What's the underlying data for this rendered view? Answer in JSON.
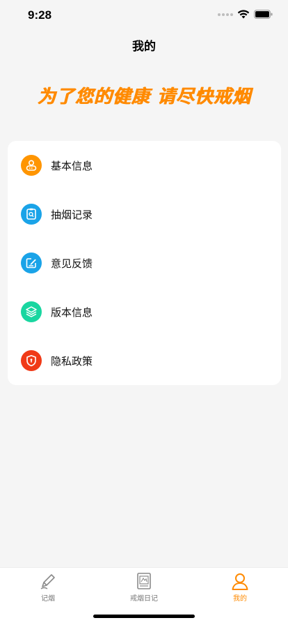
{
  "status": {
    "time": "9:28"
  },
  "header": {
    "title": "我的"
  },
  "slogan": "为了您的健康 请尽快戒烟",
  "menu": [
    {
      "label": "基本信息",
      "icon": "user-info-icon",
      "color": "#ff9500"
    },
    {
      "label": "抽烟记录",
      "icon": "record-search-icon",
      "color": "#1aa3e8"
    },
    {
      "label": "意见反馈",
      "icon": "feedback-edit-icon",
      "color": "#1aa3e8"
    },
    {
      "label": "版本信息",
      "icon": "layers-icon",
      "color": "#19d6a0"
    },
    {
      "label": "隐私政策",
      "icon": "shield-icon",
      "color": "#f03a17"
    }
  ],
  "tabs": [
    {
      "label": "记烟",
      "icon": "pen-icon",
      "active": false
    },
    {
      "label": "戒烟日记",
      "icon": "diary-icon",
      "active": false
    },
    {
      "label": "我的",
      "icon": "person-icon",
      "active": true
    }
  ],
  "colors": {
    "accent": "#ff8a00",
    "background": "#f5f5f5"
  }
}
